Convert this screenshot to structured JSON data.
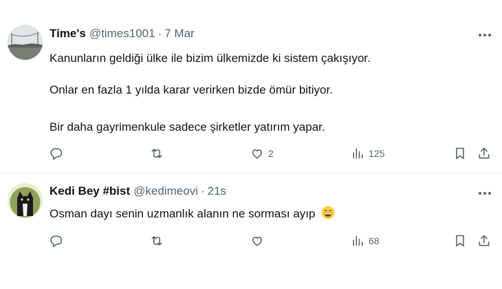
{
  "tweets": [
    {
      "display_name": "Time's",
      "handle": "@times1001",
      "separator": "·",
      "time": "7 Mar",
      "paragraphs": [
        "Kanunların geldiği ülke ile bizim ülkemizde ki sistem çakışıyor.",
        "Onlar en fazla 1 yılda karar verirken bizde ömür bitiyor.",
        "Bir daha gayrimenkule sadece şirketler yatırım yapar."
      ],
      "avatar_icon": "landscape-avatar",
      "likes": "2",
      "views": "125"
    },
    {
      "display_name": "Kedi Bey #bist",
      "handle": "@kedimeovi",
      "separator": "·",
      "time": "21s",
      "paragraphs": [
        "Osman dayı senin uzmanlık alanın ne sorması ayıp"
      ],
      "emoji": "grinning-face-emoji",
      "avatar_icon": "cat-avatar",
      "likes": "",
      "views": "68"
    }
  ],
  "icons": {
    "reply": "reply-icon",
    "retweet": "retweet-icon",
    "like": "heart-icon",
    "views": "views-chart-icon",
    "bookmark": "bookmark-icon",
    "share": "share-icon",
    "more": "more-dots-icon"
  },
  "colors": {
    "text_primary": "#0f1419",
    "text_secondary": "#536471",
    "divider": "#eff3f4"
  }
}
